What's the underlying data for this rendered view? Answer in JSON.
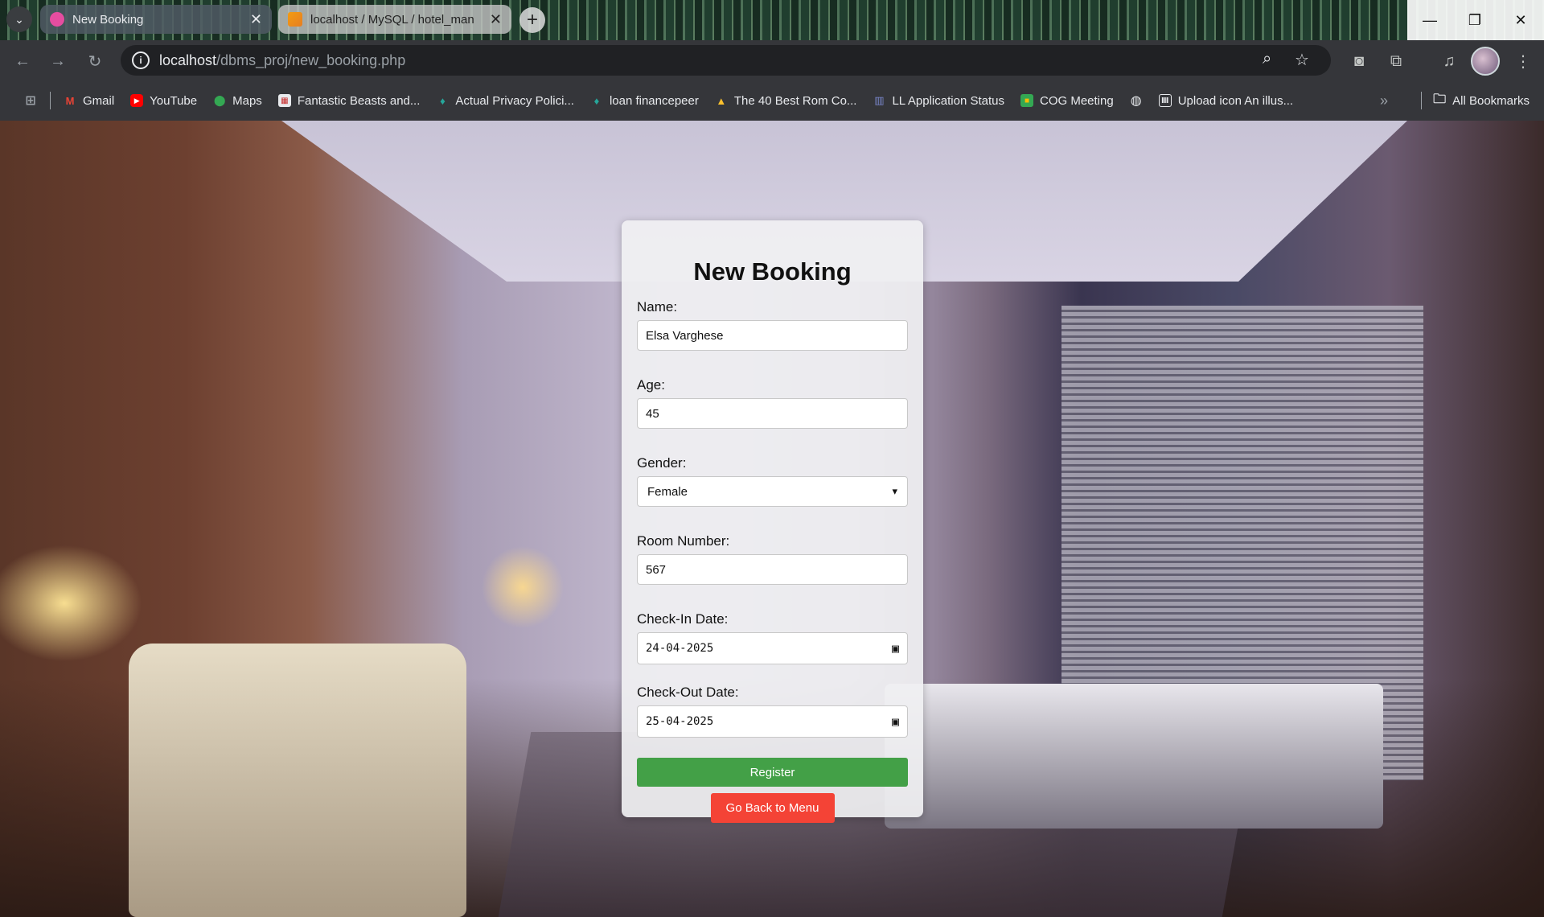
{
  "browser": {
    "tabs": [
      {
        "title": "New Booking",
        "active": true,
        "favicon": "pink-circle-icon"
      },
      {
        "title": "localhost / MySQL / hotel_man",
        "active": false,
        "favicon": "phpmyadmin-icon"
      }
    ],
    "url": {
      "host": "localhost",
      "path": "/dbms_proj/new_booking.php"
    },
    "bookmarks": [
      {
        "label": "Gmail",
        "icon": "gmail-icon"
      },
      {
        "label": "YouTube",
        "icon": "youtube-icon"
      },
      {
        "label": "Maps",
        "icon": "maps-icon"
      },
      {
        "label": "Fantastic Beasts and...",
        "icon": "site-icon"
      },
      {
        "label": "Actual Privacy Polici...",
        "icon": "leaf-icon"
      },
      {
        "label": "loan financepeer",
        "icon": "leaf-icon"
      },
      {
        "label": "The 40 Best Rom Co...",
        "icon": "warning-icon"
      },
      {
        "label": "LL Application Status",
        "icon": "city-icon"
      },
      {
        "label": "COG Meeting",
        "icon": "meet-icon"
      },
      {
        "label": "",
        "icon": "globe-icon"
      },
      {
        "label": "Upload icon An illus...",
        "icon": "building-icon"
      }
    ],
    "all_bookmarks_label": "All Bookmarks"
  },
  "form": {
    "title": "New Booking",
    "name": {
      "label": "Name:",
      "value": "Elsa Varghese"
    },
    "age": {
      "label": "Age:",
      "value": "45"
    },
    "gender": {
      "label": "Gender:",
      "value": "Female"
    },
    "room_number": {
      "label": "Room Number:",
      "value": "567"
    },
    "check_in": {
      "label": "Check-In Date:",
      "value": "24-04-2025"
    },
    "check_out": {
      "label": "Check-Out Date:",
      "value": "25-04-2025"
    },
    "register_label": "Register",
    "back_label": "Go Back to Menu"
  },
  "colors": {
    "register": "#43a047",
    "back": "#f44336"
  }
}
